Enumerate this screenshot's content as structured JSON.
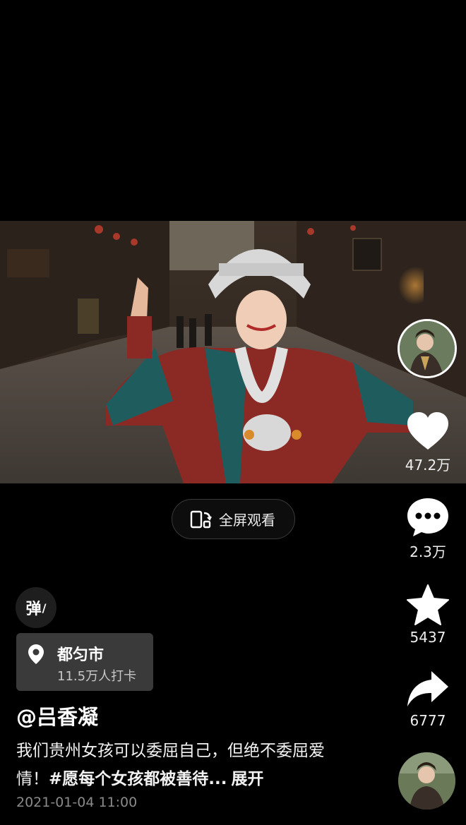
{
  "video": {
    "fullscreen_label": "全屏观看"
  },
  "rail": {
    "like_count": "47.2万",
    "comment_count": "2.3万",
    "favorite_count": "5437",
    "share_count": "6777"
  },
  "danmaku": {
    "label": "弹"
  },
  "location": {
    "name": "都匀市",
    "checkins": "11.5万人打卡"
  },
  "post": {
    "author": "@吕香凝",
    "caption_text": "我们贵州女孩可以委屈自己，但绝不委屈爱情！",
    "hashtag": "#愿每个女孩都被善待...",
    "expand_label": "展开",
    "date": "2021-01-04 11:00"
  },
  "colors": {
    "background": "#000000",
    "text_primary": "#ffffff",
    "text_muted": "#8a8a8a",
    "card_bg": "#3a3a3a"
  },
  "icons": [
    "fullscreen-rotate-icon",
    "heart-icon",
    "comment-bubble-icon",
    "star-icon",
    "share-arrow-icon",
    "location-pin-icon"
  ]
}
